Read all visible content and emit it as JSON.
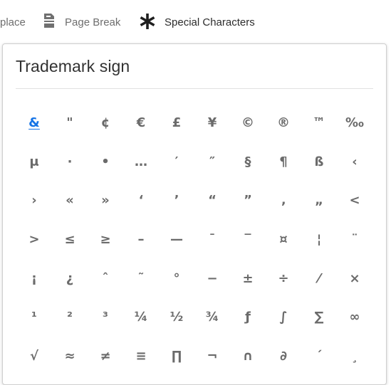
{
  "toolbar": {
    "replace_label": "place",
    "page_break_label": "Page Break",
    "special_characters_label": "Special Characters",
    "icons": {
      "page_break": "page-break-icon",
      "special_characters": "asterisk-icon"
    }
  },
  "popover": {
    "title": "Trademark sign",
    "selected_index": 0,
    "selected_color": "#1473e6",
    "characters": [
      "&",
      "\"",
      "¢",
      "€",
      "£",
      "¥",
      "©",
      "®",
      "™",
      "‰",
      "μ",
      "·",
      "•",
      "…",
      "′",
      "″",
      "§",
      "¶",
      "ß",
      "‹",
      "›",
      "«",
      "»",
      "‘",
      "’",
      "“",
      "”",
      "‚",
      "„",
      "<",
      ">",
      "≤",
      "≥",
      "–",
      "—",
      "¯",
      "‾",
      "¤",
      "¦",
      "¨",
      "¡",
      "¿",
      "ˆ",
      "˜",
      "°",
      "−",
      "±",
      "÷",
      "⁄",
      "×",
      "¹",
      "²",
      "³",
      "¼",
      "½",
      "¾",
      "ƒ",
      "∫",
      "∑",
      "∞",
      "√",
      "≈",
      "≠",
      "≡",
      "∏",
      "¬",
      "∩",
      "∂",
      "´",
      "¸"
    ]
  }
}
